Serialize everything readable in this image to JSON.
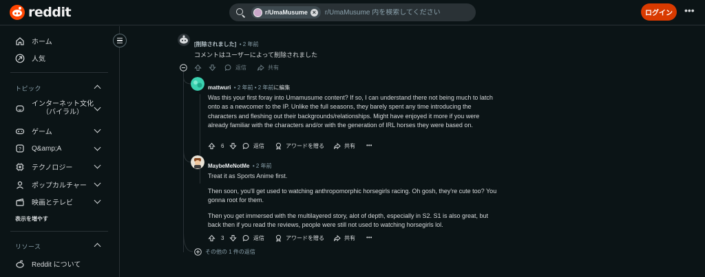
{
  "header": {
    "logo_text": "reddit",
    "search_chip": "r/UmaMusume",
    "search_placeholder": "r/UmaMusume 内を検索してください",
    "login_label": "ログイン",
    "more_label": "•••"
  },
  "sidebar": {
    "home": "ホーム",
    "popular": "人気",
    "topics_heading": "トピック",
    "topics": [
      {
        "label_line1": "インターネット文化",
        "label_line2": "（バイラル）"
      },
      {
        "label": "ゲーム"
      },
      {
        "label": "Q&amp;A"
      },
      {
        "label": "テクノロジー"
      },
      {
        "label": "ポップカルチャー"
      },
      {
        "label": "映画とテレビ"
      }
    ],
    "show_more": "表示を増やす",
    "resources_heading": "リソース",
    "about_reddit": "Reddit について"
  },
  "thread": {
    "deleted": {
      "author": "[削除されました]",
      "time": "• 2 年前",
      "body": "コメントはユーザーによって削除されました",
      "reply_label": "返信",
      "share_label": "共有"
    },
    "reply1": {
      "author": "mattwuri",
      "time": "• 2 年前 • 2 年前",
      "edited": "に編集",
      "body": "Was this your first foray into Umamusume content? If so, I can understand there not being much to latch onto as a newcomer to the IP. Unlike the full seasons, they barely spent any time introducing the characters and fleshing out their backgrounds/relationships. Might have enjoyed it more if you were already familiar with the characters and/or with the generation of IRL horses they were based on.",
      "votes": "6",
      "reply_label": "返信",
      "award_label": "アワードを贈る",
      "share_label": "共有",
      "more_label": "•••"
    },
    "reply2": {
      "author": "MaybeMeNotMe",
      "time": "• 2 年前",
      "paragraphs": [
        "Treat it as Sports Anime first.",
        "Then soon, you'll get used to watching anthropomorphic horsegirls racing. Oh gosh, they're cute too? You gonna root for them.",
        "Then you get immersed with the multilayered story, alot of depth, especially in S2. S1 is also great, but back then if you read the reviews, people were still not used to watching horsegirls lol."
      ],
      "votes": "3",
      "reply_label": "返信",
      "award_label": "アワードを贈る",
      "share_label": "共有",
      "more_label": "•••"
    },
    "more_replies": "その他の 1 件の返信"
  },
  "colors": {
    "background": "#0b1416",
    "accent": "#d93a00",
    "reddit_orange": "#ff4500",
    "muted_text": "#8ba2ad"
  }
}
